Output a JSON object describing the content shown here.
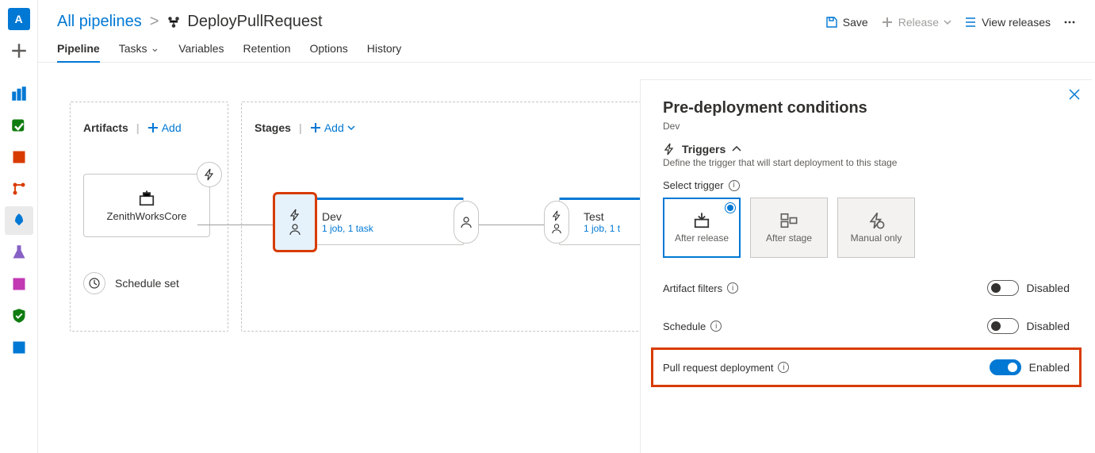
{
  "rail": {
    "avatar_letter": "A"
  },
  "breadcrumb": {
    "back_label": "All pipelines",
    "current": "DeployPullRequest"
  },
  "header_actions": {
    "save": "Save",
    "release": "Release",
    "view_releases": "View releases"
  },
  "tabs": {
    "pipeline": "Pipeline",
    "tasks": "Tasks",
    "variables": "Variables",
    "retention": "Retention",
    "options": "Options",
    "history": "History"
  },
  "artifacts": {
    "title": "Artifacts",
    "add": "Add",
    "card_name": "ZenithWorksCore",
    "schedule": "Schedule set"
  },
  "stages": {
    "title": "Stages",
    "add": "Add",
    "list": [
      {
        "name": "Dev",
        "meta": "1 job, 1 task"
      },
      {
        "name": "Test",
        "meta": "1 job, 1 t"
      }
    ]
  },
  "side_panel": {
    "title": "Pre-deployment conditions",
    "subtitle": "Dev",
    "triggers_header": "Triggers",
    "triggers_desc": "Define the trigger that will start deployment to this stage",
    "select_trigger_label": "Select trigger",
    "trigger_options": {
      "after_release": "After release",
      "after_stage": "After stage",
      "manual_only": "Manual only"
    },
    "artifact_filters": {
      "label": "Artifact filters",
      "state": "Disabled"
    },
    "schedule": {
      "label": "Schedule",
      "state": "Disabled"
    },
    "pr_deploy": {
      "label": "Pull request deployment",
      "state": "Enabled"
    }
  }
}
